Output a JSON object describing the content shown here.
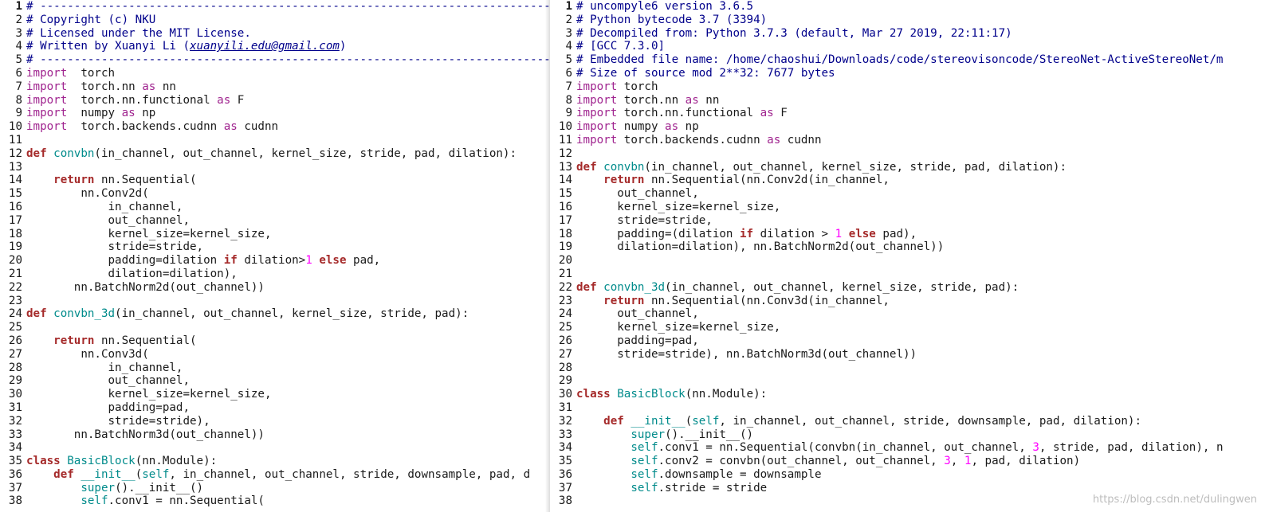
{
  "left_pane": {
    "lines": [
      {
        "n": "1",
        "t": [
          [
            "cmt",
            "# --------------------------------------------------------------------------------------------------------"
          ]
        ]
      },
      {
        "n": "2",
        "t": [
          [
            "cmt",
            "# Copyright (c) NKU"
          ]
        ]
      },
      {
        "n": "3",
        "t": [
          [
            "cmt",
            "# Licensed under the MIT License."
          ]
        ]
      },
      {
        "n": "4",
        "t": [
          [
            "cmt",
            "# Written by Xuanyi Li ("
          ],
          [
            "link",
            "xuanyili.edu@gmail.com"
          ],
          [
            "cmt",
            ")"
          ]
        ]
      },
      {
        "n": "5",
        "t": [
          [
            "cmt",
            "# --------------------------------------------------------------------------------------------------------"
          ]
        ]
      },
      {
        "n": "6",
        "t": [
          [
            "kw",
            "import"
          ],
          [
            "",
            "  torch"
          ]
        ]
      },
      {
        "n": "7",
        "t": [
          [
            "kw",
            "import"
          ],
          [
            "",
            "  torch.nn "
          ],
          [
            "kw",
            "as"
          ],
          [
            "",
            " nn"
          ]
        ]
      },
      {
        "n": "8",
        "t": [
          [
            "kw",
            "import"
          ],
          [
            "",
            "  torch.nn.functional "
          ],
          [
            "kw",
            "as"
          ],
          [
            "",
            " F"
          ]
        ]
      },
      {
        "n": "9",
        "t": [
          [
            "kw",
            "import"
          ],
          [
            "",
            "  numpy "
          ],
          [
            "kw",
            "as"
          ],
          [
            "",
            " np"
          ]
        ]
      },
      {
        "n": "10",
        "t": [
          [
            "kw",
            "import"
          ],
          [
            "",
            "  torch.backends.cudnn "
          ],
          [
            "kw",
            "as"
          ],
          [
            "",
            " cudnn"
          ]
        ]
      },
      {
        "n": "11",
        "t": []
      },
      {
        "n": "12",
        "t": [
          [
            "kwb",
            "def"
          ],
          [
            "",
            " "
          ],
          [
            "fn",
            "convbn"
          ],
          [
            "",
            "(in_channel, out_channel, kernel_size, stride, pad, dilation):"
          ]
        ]
      },
      {
        "n": "13",
        "t": []
      },
      {
        "n": "14",
        "t": [
          [
            "",
            "    "
          ],
          [
            "kwb",
            "return"
          ],
          [
            "",
            " nn.Sequential("
          ]
        ]
      },
      {
        "n": "15",
        "t": [
          [
            "",
            "        nn.Conv2d("
          ]
        ]
      },
      {
        "n": "16",
        "t": [
          [
            "",
            "            in_channel,"
          ]
        ]
      },
      {
        "n": "17",
        "t": [
          [
            "",
            "            out_channel,"
          ]
        ]
      },
      {
        "n": "18",
        "t": [
          [
            "",
            "            kernel_size=kernel_size,"
          ]
        ]
      },
      {
        "n": "19",
        "t": [
          [
            "",
            "            stride=stride,"
          ]
        ]
      },
      {
        "n": "20",
        "t": [
          [
            "",
            "            padding=dilation "
          ],
          [
            "kwb",
            "if"
          ],
          [
            "",
            " dilation>"
          ],
          [
            "num",
            "1"
          ],
          [
            "",
            " "
          ],
          [
            "kwb",
            "else"
          ],
          [
            "",
            " pad,"
          ]
        ]
      },
      {
        "n": "21",
        "t": [
          [
            "",
            "            dilation=dilation),"
          ]
        ]
      },
      {
        "n": "22",
        "t": [
          [
            "",
            "       nn.BatchNorm2d(out_channel))"
          ]
        ]
      },
      {
        "n": "23",
        "t": []
      },
      {
        "n": "24",
        "t": [
          [
            "kwb",
            "def"
          ],
          [
            "",
            " "
          ],
          [
            "fn",
            "convbn_3d"
          ],
          [
            "",
            "(in_channel, out_channel, kernel_size, stride, pad):"
          ]
        ]
      },
      {
        "n": "25",
        "t": []
      },
      {
        "n": "26",
        "t": [
          [
            "",
            "    "
          ],
          [
            "kwb",
            "return"
          ],
          [
            "",
            " nn.Sequential("
          ]
        ]
      },
      {
        "n": "27",
        "t": [
          [
            "",
            "        nn.Conv3d("
          ]
        ]
      },
      {
        "n": "28",
        "t": [
          [
            "",
            "            in_channel,"
          ]
        ]
      },
      {
        "n": "29",
        "t": [
          [
            "",
            "            out_channel,"
          ]
        ]
      },
      {
        "n": "30",
        "t": [
          [
            "",
            "            kernel_size=kernel_size,"
          ]
        ]
      },
      {
        "n": "31",
        "t": [
          [
            "",
            "            padding=pad,"
          ]
        ]
      },
      {
        "n": "32",
        "t": [
          [
            "",
            "            stride=stride),"
          ]
        ]
      },
      {
        "n": "33",
        "t": [
          [
            "",
            "       nn.BatchNorm3d(out_channel))"
          ]
        ]
      },
      {
        "n": "34",
        "t": []
      },
      {
        "n": "35",
        "t": [
          [
            "kwb",
            "class"
          ],
          [
            "",
            " "
          ],
          [
            "fn",
            "BasicBlock"
          ],
          [
            "",
            "(nn.Module):"
          ]
        ]
      },
      {
        "n": "36",
        "t": [
          [
            "",
            "    "
          ],
          [
            "kwb",
            "def"
          ],
          [
            "",
            " "
          ],
          [
            "fn",
            "__init__"
          ],
          [
            "",
            "("
          ],
          [
            "fn",
            "self"
          ],
          [
            "",
            ", in_channel, out_channel, stride, downsample, pad, d"
          ]
        ]
      },
      {
        "n": "37",
        "t": [
          [
            "",
            "        "
          ],
          [
            "fn",
            "super"
          ],
          [
            "",
            "().__init__()"
          ]
        ]
      },
      {
        "n": "38",
        "t": [
          [
            "",
            "        "
          ],
          [
            "fn",
            "self"
          ],
          [
            "",
            ".conv1 = nn.Sequential("
          ]
        ]
      }
    ]
  },
  "right_pane": {
    "lines": [
      {
        "n": "1",
        "t": [
          [
            "cmt",
            "# uncompyle6 version 3.6.5"
          ]
        ]
      },
      {
        "n": "2",
        "t": [
          [
            "cmt",
            "# Python bytecode 3.7 (3394)"
          ]
        ]
      },
      {
        "n": "3",
        "t": [
          [
            "cmt",
            "# Decompiled from: Python 3.7.3 (default, Mar 27 2019, 22:11:17)"
          ]
        ]
      },
      {
        "n": "4",
        "t": [
          [
            "cmt",
            "# [GCC 7.3.0]"
          ]
        ]
      },
      {
        "n": "5",
        "t": [
          [
            "cmt",
            "# Embedded file name: /home/chaoshui/Downloads/code/stereovisoncode/StereoNet-ActiveStereoNet/m"
          ]
        ]
      },
      {
        "n": "6",
        "t": [
          [
            "cmt",
            "# Size of source mod 2**32: 7677 bytes"
          ]
        ]
      },
      {
        "n": "7",
        "t": [
          [
            "kw",
            "import"
          ],
          [
            "",
            " torch"
          ]
        ]
      },
      {
        "n": "8",
        "t": [
          [
            "kw",
            "import"
          ],
          [
            "",
            " torch.nn "
          ],
          [
            "kw",
            "as"
          ],
          [
            "",
            " nn"
          ]
        ]
      },
      {
        "n": "9",
        "t": [
          [
            "kw",
            "import"
          ],
          [
            "",
            " torch.nn.functional "
          ],
          [
            "kw",
            "as"
          ],
          [
            "",
            " F"
          ]
        ]
      },
      {
        "n": "10",
        "t": [
          [
            "kw",
            "import"
          ],
          [
            "",
            " numpy "
          ],
          [
            "kw",
            "as"
          ],
          [
            "",
            " np"
          ]
        ]
      },
      {
        "n": "11",
        "t": [
          [
            "kw",
            "import"
          ],
          [
            "",
            " torch.backends.cudnn "
          ],
          [
            "kw",
            "as"
          ],
          [
            "",
            " cudnn"
          ]
        ]
      },
      {
        "n": "12",
        "t": []
      },
      {
        "n": "13",
        "t": [
          [
            "kwb",
            "def"
          ],
          [
            "",
            " "
          ],
          [
            "fn",
            "convbn"
          ],
          [
            "",
            "(in_channel, out_channel, kernel_size, stride, pad, dilation):"
          ]
        ]
      },
      {
        "n": "14",
        "t": [
          [
            "",
            "    "
          ],
          [
            "kwb",
            "return"
          ],
          [
            "",
            " nn.Sequential(nn.Conv2d(in_channel,"
          ]
        ]
      },
      {
        "n": "15",
        "t": [
          [
            "",
            "      out_channel,"
          ]
        ]
      },
      {
        "n": "16",
        "t": [
          [
            "",
            "      kernel_size=kernel_size,"
          ]
        ]
      },
      {
        "n": "17",
        "t": [
          [
            "",
            "      stride=stride,"
          ]
        ]
      },
      {
        "n": "18",
        "t": [
          [
            "",
            "      padding=(dilation "
          ],
          [
            "kwb",
            "if"
          ],
          [
            "",
            " dilation > "
          ],
          [
            "num",
            "1"
          ],
          [
            "",
            " "
          ],
          [
            "kwb",
            "else"
          ],
          [
            "",
            " pad),"
          ]
        ]
      },
      {
        "n": "19",
        "t": [
          [
            "",
            "      dilation=dilation), nn.BatchNorm2d(out_channel))"
          ]
        ]
      },
      {
        "n": "20",
        "t": []
      },
      {
        "n": "21",
        "t": []
      },
      {
        "n": "22",
        "t": [
          [
            "kwb",
            "def"
          ],
          [
            "",
            " "
          ],
          [
            "fn",
            "convbn_3d"
          ],
          [
            "",
            "(in_channel, out_channel, kernel_size, stride, pad):"
          ]
        ]
      },
      {
        "n": "23",
        "t": [
          [
            "",
            "    "
          ],
          [
            "kwb",
            "return"
          ],
          [
            "",
            " nn.Sequential(nn.Conv3d(in_channel,"
          ]
        ]
      },
      {
        "n": "24",
        "t": [
          [
            "",
            "      out_channel,"
          ]
        ]
      },
      {
        "n": "25",
        "t": [
          [
            "",
            "      kernel_size=kernel_size,"
          ]
        ]
      },
      {
        "n": "26",
        "t": [
          [
            "",
            "      padding=pad,"
          ]
        ]
      },
      {
        "n": "27",
        "t": [
          [
            "",
            "      stride=stride), nn.BatchNorm3d(out_channel))"
          ]
        ]
      },
      {
        "n": "28",
        "t": []
      },
      {
        "n": "29",
        "t": []
      },
      {
        "n": "30",
        "t": [
          [
            "kwb",
            "class"
          ],
          [
            "",
            " "
          ],
          [
            "fn",
            "BasicBlock"
          ],
          [
            "",
            "(nn.Module):"
          ]
        ]
      },
      {
        "n": "31",
        "t": []
      },
      {
        "n": "32",
        "t": [
          [
            "",
            "    "
          ],
          [
            "kwb",
            "def"
          ],
          [
            "",
            " "
          ],
          [
            "fn",
            "__init__"
          ],
          [
            "",
            "("
          ],
          [
            "fn",
            "self"
          ],
          [
            "",
            ", in_channel, out_channel, stride, downsample, pad, dilation):"
          ]
        ]
      },
      {
        "n": "33",
        "t": [
          [
            "",
            "        "
          ],
          [
            "fn",
            "super"
          ],
          [
            "",
            "().__init__()"
          ]
        ]
      },
      {
        "n": "34",
        "t": [
          [
            "",
            "        "
          ],
          [
            "fn",
            "self"
          ],
          [
            "",
            ".conv1 = nn.Sequential(convbn(in_channel, out_channel, "
          ],
          [
            "num",
            "3"
          ],
          [
            "",
            ", stride, pad, dilation), n"
          ]
        ]
      },
      {
        "n": "35",
        "t": [
          [
            "",
            "        "
          ],
          [
            "fn",
            "self"
          ],
          [
            "",
            ".conv2 = convbn(out_channel, out_channel, "
          ],
          [
            "num",
            "3"
          ],
          [
            "",
            ", "
          ],
          [
            "num",
            "1"
          ],
          [
            "",
            ", pad, dilation)"
          ]
        ]
      },
      {
        "n": "36",
        "t": [
          [
            "",
            "        "
          ],
          [
            "fn",
            "self"
          ],
          [
            "",
            ".downsample = downsample"
          ]
        ]
      },
      {
        "n": "37",
        "t": [
          [
            "",
            "        "
          ],
          [
            "fn",
            "self"
          ],
          [
            "",
            ".stride = stride"
          ]
        ]
      },
      {
        "n": "38",
        "t": []
      }
    ]
  },
  "watermark": "https://blog.csdn.net/dulingwen",
  "colors": {
    "keyword": "#a0248f",
    "keyword_bold": "#a52a2a",
    "function": "#008b8b",
    "comment": "#00008b",
    "number": "#ff00ff"
  }
}
